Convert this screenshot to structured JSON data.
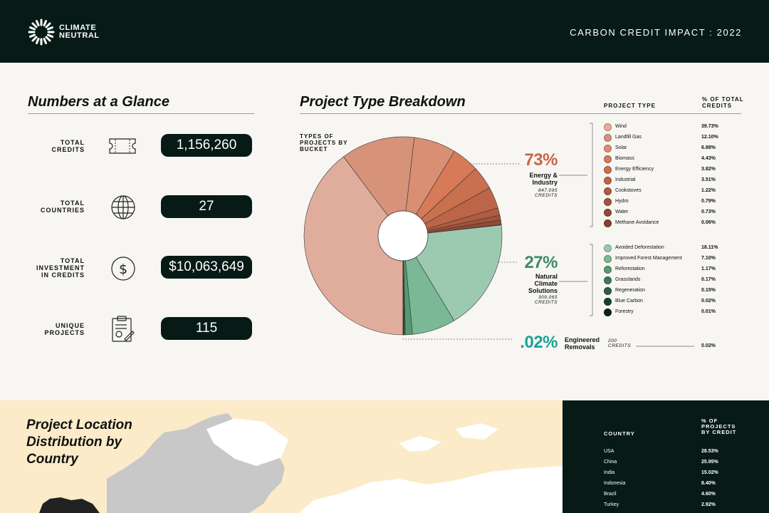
{
  "header": {
    "brand_line1": "CLIMATE",
    "brand_line2": "NEUTRAL",
    "report_title": "CARBON CREDIT IMPACT : 2022"
  },
  "glance": {
    "title": "Numbers at a Glance",
    "stats": [
      {
        "label": "TOTAL\nCREDITS",
        "icon": "ticket-icon",
        "value": "1,156,260"
      },
      {
        "label": "TOTAL\nCOUNTRIES",
        "icon": "globe-icon",
        "value": "27"
      },
      {
        "label": "TOTAL\nINVESTMENT\nIN CREDITS",
        "icon": "dollar-icon",
        "value": "$10,063,649"
      },
      {
        "label": "UNIQUE\nPROJECTS",
        "icon": "clipboard-icon",
        "value": "115"
      }
    ]
  },
  "breakdown": {
    "title": "Project Type Breakdown",
    "pie_caption": "TYPES OF\nPROJECTS BY\nBUCKET",
    "col_project_type": "PROJECT TYPE",
    "col_pct": "% OF TOTAL\nCREDITS",
    "buckets": [
      {
        "pct": "73%",
        "name": "Energy &\nIndustry",
        "credits": "847,095\nCREDITS",
        "color": "#c6674a"
      },
      {
        "pct": "27%",
        "name": "Natural\nClimate\nSolutions",
        "credits": "309,065\nCREDITS",
        "color": "#3e8a63"
      },
      {
        "pct": ".02%",
        "name": "Engineered\nRemovals",
        "credits": "200\nCREDITS",
        "color": "#1aa39a"
      }
    ],
    "energy_types": [
      {
        "name": "Wind",
        "pct": "39.73%",
        "color": "#e0ad9c"
      },
      {
        "name": "Landfill Gas",
        "pct": "12.10%",
        "color": "#d6937a"
      },
      {
        "name": "Solar",
        "pct": "6.88%",
        "color": "#d88f73"
      },
      {
        "name": "Biomass",
        "pct": "4.43%",
        "color": "#d77a58"
      },
      {
        "name": "Energy Efficiency",
        "pct": "3.82%",
        "color": "#c9704f"
      },
      {
        "name": "Industrial",
        "pct": "3.51%",
        "color": "#bd6548"
      },
      {
        "name": "Cookstoves",
        "pct": "1.22%",
        "color": "#b05c41"
      },
      {
        "name": "Hydro",
        "pct": "0.79%",
        "color": "#a2533a"
      },
      {
        "name": "Water",
        "pct": "0.73%",
        "color": "#934a33"
      },
      {
        "name": "Methane Avoidance",
        "pct": "0.06%",
        "color": "#84412c"
      }
    ],
    "nature_types": [
      {
        "name": "Avoided Deforestation",
        "pct": "18.11%",
        "color": "#9ccab1"
      },
      {
        "name": "Improved Forest Management",
        "pct": "7.10%",
        "color": "#7ab896"
      },
      {
        "name": "Reforestation",
        "pct": "1.17%",
        "color": "#559a73"
      },
      {
        "name": "Grasslands",
        "pct": "0.17%",
        "color": "#3b7a58"
      },
      {
        "name": "Regeneration",
        "pct": "0.15%",
        "color": "#2a5e43"
      },
      {
        "name": "Blue Carbon",
        "pct": "0.02%",
        "color": "#1b3f2d"
      },
      {
        "name": "Forestry",
        "pct": "0.01%",
        "color": "#0d2219"
      }
    ],
    "removals_pct": "0.02%"
  },
  "location": {
    "title": "Project Location\nDistribution by\nCountry",
    "col_country": "COUNTRY",
    "col_pct": "% OF\nPROJECTS\nBY CREDIT",
    "countries": [
      {
        "name": "USA",
        "pct": "28.53%"
      },
      {
        "name": "China",
        "pct": "25.95%"
      },
      {
        "name": "India",
        "pct": "15.02%"
      },
      {
        "name": "Indonesia",
        "pct": "8.40%"
      },
      {
        "name": "Brazil",
        "pct": "4.60%"
      },
      {
        "name": "Turkey",
        "pct": "2.92%"
      }
    ]
  },
  "colors": {
    "dark": "#071a16",
    "cream": "#fbebc8",
    "energy_accent": "#c6674a",
    "nature_accent": "#3e8a63",
    "removal_accent": "#1aa39a"
  }
}
